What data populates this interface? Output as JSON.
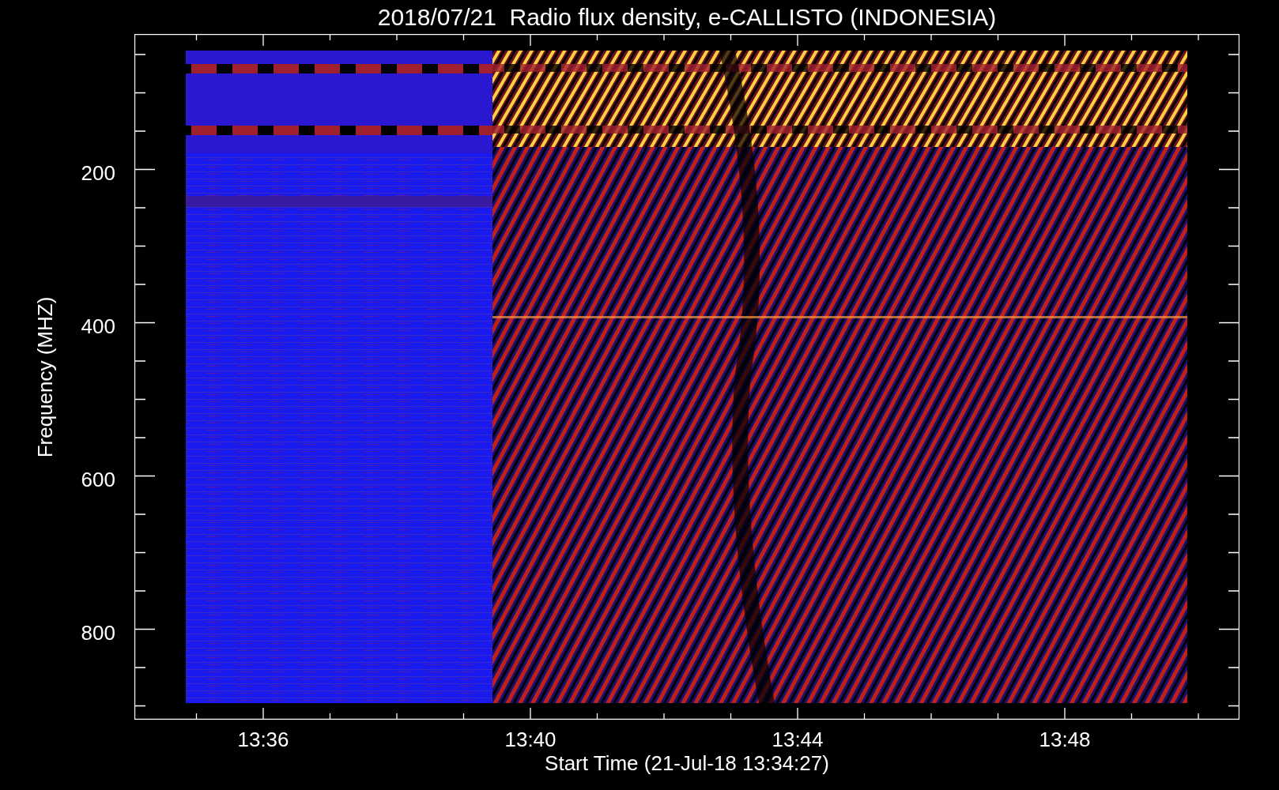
{
  "title": "2018/07/21  Radio flux density, e-CALLISTO (INDONESIA)",
  "y_axis": {
    "label": "Frequency (MHZ)",
    "ticks": [
      "200",
      "400",
      "600",
      "800"
    ]
  },
  "x_axis": {
    "label": "Start Time (21-Jul-18 13:34:27)",
    "ticks": [
      "13:36",
      "13:40",
      "13:44",
      "13:48"
    ]
  }
}
